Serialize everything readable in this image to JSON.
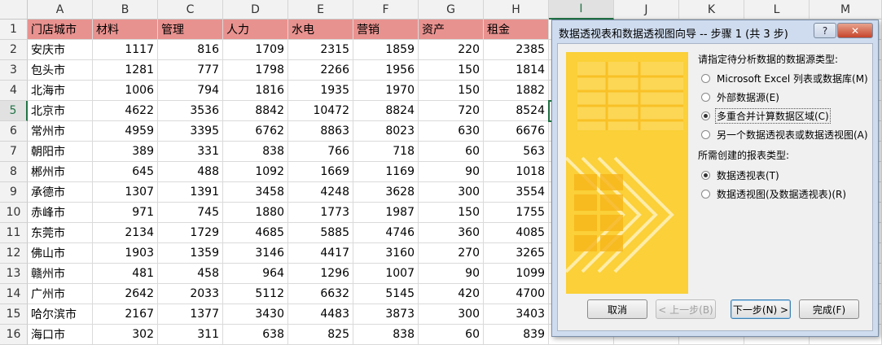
{
  "spreadsheet": {
    "columns": [
      "A",
      "B",
      "C",
      "D",
      "E",
      "F",
      "G",
      "H",
      "I",
      "J",
      "K",
      "L",
      "M"
    ],
    "active_column": "I",
    "active_row": 5,
    "rows": [
      {
        "n": "1",
        "cells": [
          "门店城市",
          "材料",
          "管理",
          "人力",
          "水电",
          "营销",
          "资产",
          "租金"
        ]
      },
      {
        "n": "2",
        "cells": [
          "安庆市",
          "1117",
          "816",
          "1709",
          "2315",
          "1859",
          "220",
          "2385"
        ]
      },
      {
        "n": "3",
        "cells": [
          "包头市",
          "1281",
          "777",
          "1798",
          "2266",
          "1956",
          "150",
          "1814"
        ]
      },
      {
        "n": "4",
        "cells": [
          "北海市",
          "1006",
          "794",
          "1816",
          "1935",
          "1970",
          "150",
          "1882"
        ]
      },
      {
        "n": "5",
        "cells": [
          "北京市",
          "4622",
          "3536",
          "8842",
          "10472",
          "8824",
          "720",
          "8524"
        ]
      },
      {
        "n": "6",
        "cells": [
          "常州市",
          "4959",
          "3395",
          "6762",
          "8863",
          "8023",
          "630",
          "6676"
        ]
      },
      {
        "n": "7",
        "cells": [
          "朝阳市",
          "389",
          "331",
          "838",
          "766",
          "718",
          "60",
          "563"
        ]
      },
      {
        "n": "8",
        "cells": [
          "郴州市",
          "645",
          "488",
          "1092",
          "1669",
          "1169",
          "90",
          "1018"
        ]
      },
      {
        "n": "9",
        "cells": [
          "承德市",
          "1307",
          "1391",
          "3458",
          "4248",
          "3628",
          "300",
          "3554"
        ]
      },
      {
        "n": "10",
        "cells": [
          "赤峰市",
          "971",
          "745",
          "1880",
          "1773",
          "1987",
          "150",
          "1755"
        ]
      },
      {
        "n": "11",
        "cells": [
          "东莞市",
          "2134",
          "1729",
          "4685",
          "5885",
          "4746",
          "360",
          "4085"
        ]
      },
      {
        "n": "12",
        "cells": [
          "佛山市",
          "1903",
          "1359",
          "3146",
          "4417",
          "3160",
          "270",
          "3265"
        ]
      },
      {
        "n": "13",
        "cells": [
          "赣州市",
          "481",
          "458",
          "964",
          "1296",
          "1007",
          "90",
          "1099"
        ]
      },
      {
        "n": "14",
        "cells": [
          "广州市",
          "2642",
          "2033",
          "5112",
          "6632",
          "5145",
          "420",
          "4700"
        ]
      },
      {
        "n": "15",
        "cells": [
          "哈尔滨市",
          "2167",
          "1377",
          "3430",
          "4483",
          "3873",
          "300",
          "3403"
        ]
      },
      {
        "n": "16",
        "cells": [
          "海口市",
          "302",
          "311",
          "638",
          "825",
          "838",
          "60",
          "839"
        ]
      }
    ]
  },
  "dialog": {
    "title": "数据透视表和数据透视图向导 -- 步骤 1 (共 3 步)",
    "help_label": "?",
    "close_label": "✕",
    "source_prompt": "请指定待分析数据的数据源类型:",
    "source_options": [
      {
        "label": "Microsoft Excel 列表或数据库(M)",
        "selected": false
      },
      {
        "label": "外部数据源(E)",
        "selected": false
      },
      {
        "label": "多重合并计算数据区域(C)",
        "selected": true
      },
      {
        "label": "另一个数据透视表或数据透视图(A)",
        "selected": false
      }
    ],
    "report_prompt": "所需创建的报表类型:",
    "report_options": [
      {
        "label": "数据透视表(T)",
        "selected": true
      },
      {
        "label": "数据透视图(及数据透视表)(R)",
        "selected": false
      }
    ],
    "buttons": {
      "cancel": "取消",
      "back": "< 上一步(B)",
      "next": "下一步(N) >",
      "finish": "完成(F)"
    },
    "colors": {
      "art_yellow": "#fbd038",
      "header_fill": "#e8928f",
      "selection": "#217346"
    }
  }
}
